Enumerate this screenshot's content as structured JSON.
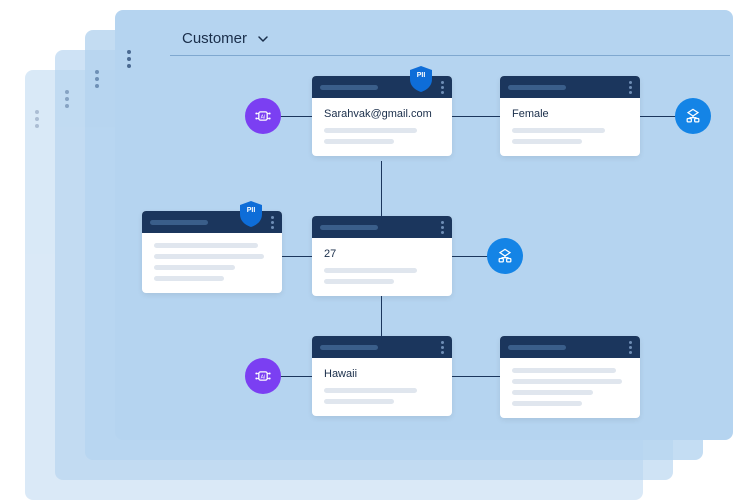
{
  "header": {
    "title": "Customer"
  },
  "badges": {
    "pii": "PII"
  },
  "cards": {
    "email": {
      "label": "Sarahvak@gmail.com"
    },
    "gender": {
      "label": "Female"
    },
    "age": {
      "label": "27"
    },
    "location": {
      "label": "Hawaii"
    }
  }
}
